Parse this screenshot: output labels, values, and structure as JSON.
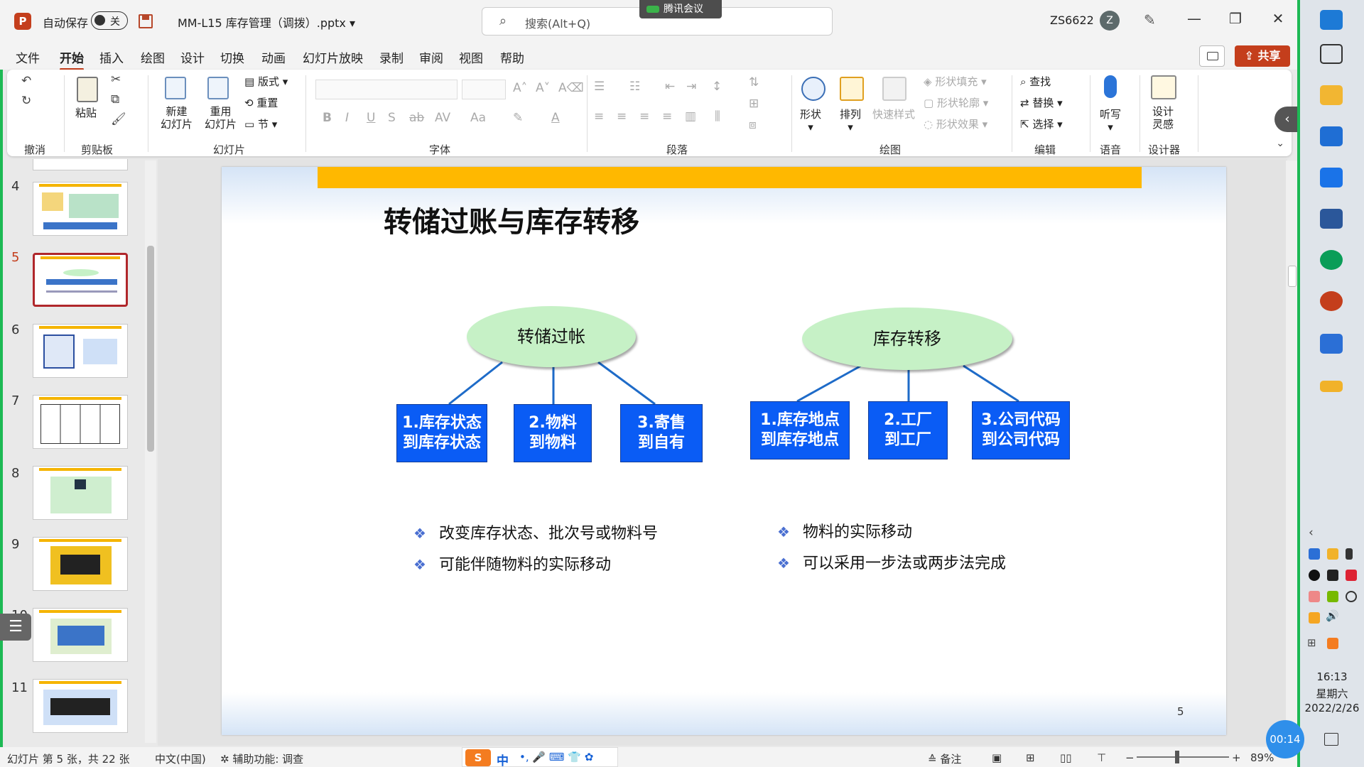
{
  "titlebar": {
    "app_icon": "powerpoint-icon",
    "autosave_label": "自动保存",
    "autosave_state": "关",
    "document_title": "MM-L15 库存管理（调拨）.pptx",
    "search_placeholder": "搜索(Alt+Q)",
    "meeting_badge": "腾讯会议",
    "account_name": "ZS6622",
    "avatar_initial": "Z"
  },
  "ribbon_tabs": [
    "文件",
    "开始",
    "插入",
    "绘图",
    "设计",
    "切换",
    "动画",
    "幻灯片放映",
    "录制",
    "审阅",
    "视图",
    "帮助"
  ],
  "active_tab": "开始",
  "share_label": "共享",
  "ribbon": {
    "groups": {
      "undo": "撤消",
      "clipboard": "剪贴板",
      "slides": "幻灯片",
      "font": "字体",
      "paragraph": "段落",
      "drawing": "绘图",
      "editing": "编辑",
      "voice": "语音",
      "designer": "设计器"
    },
    "buttons": {
      "paste": "粘贴",
      "new_slide_1": "新建",
      "new_slide_2": "幻灯片",
      "reuse_1": "重用",
      "reuse_2": "幻灯片",
      "layout": "版式",
      "reset": "重置",
      "section": "节",
      "shape": "形状",
      "arrange": "排列",
      "quick_styles": "快速样式",
      "shape_fill": "形状填充",
      "shape_outline": "形状轮廓",
      "shape_effects": "形状效果",
      "find": "查找",
      "replace": "替换",
      "select": "选择",
      "dictate": "听写",
      "design_ideas_1": "设计",
      "design_ideas_2": "灵感"
    },
    "font_buttons": [
      "B",
      "I",
      "U",
      "S",
      "ab",
      "AV",
      "Aa",
      "A"
    ]
  },
  "thumbnails": [
    {
      "num": "4",
      "selected": false
    },
    {
      "num": "5",
      "selected": true
    },
    {
      "num": "6",
      "selected": false
    },
    {
      "num": "7",
      "selected": false
    },
    {
      "num": "8",
      "selected": false
    },
    {
      "num": "9",
      "selected": false
    },
    {
      "num": "10",
      "selected": false
    },
    {
      "num": "11",
      "selected": false
    }
  ],
  "slide": {
    "title": "转储过账与库存转移",
    "left_node": "转储过帐",
    "right_node": "库存转移",
    "left_boxes": [
      [
        "1.库存状态",
        "到库存状态"
      ],
      [
        "2.物料",
        "到物料"
      ],
      [
        "3.寄售",
        "到自有"
      ]
    ],
    "right_boxes": [
      [
        "1.库存地点",
        "到库存地点"
      ],
      [
        "2.工厂",
        "到工厂"
      ],
      [
        "3.公司代码",
        "到公司代码"
      ]
    ],
    "left_bullets": [
      "改变库存状态、批次号或物料号",
      "可能伴随物料的实际移动"
    ],
    "right_bullets": [
      "物料的实际移动",
      "可以采用一步法或两步法完成"
    ],
    "page_number": "5",
    "colors": {
      "gold_bar": "#ffb800",
      "box_blue": "#0a5cf5",
      "ellipse_green": "#c6f1c6"
    }
  },
  "statusbar": {
    "slide_info": "幻灯片 第 5 张，共 22 张",
    "language": "中文(中国)",
    "accessibility": "辅助功能: 调查",
    "ime_label": "中",
    "notes": "备注",
    "zoom": "89%"
  },
  "taskbar": {
    "time": "16:13",
    "weekday": "星期六",
    "date": "2022/2/26",
    "meeting_timer": "00:14"
  }
}
